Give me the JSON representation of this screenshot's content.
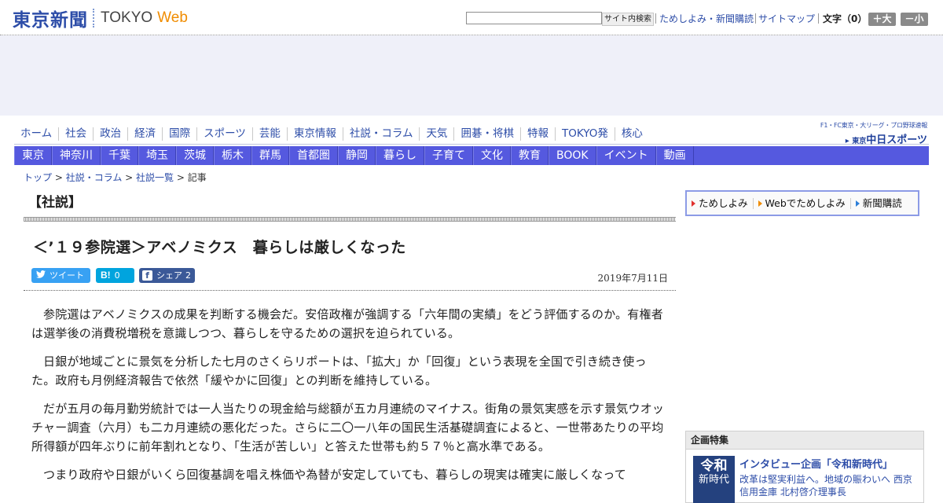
{
  "header": {
    "logo_jp": "東京新聞",
    "logo_tokyo": "TOKYO",
    "logo_web": "Web",
    "search_value": "",
    "search_button": "サイト内検索",
    "links": [
      "ためしよみ・新聞購読",
      "サイトマップ"
    ],
    "fontsize_label": "文字（0）",
    "bigger": "＋大",
    "smaller": "－小"
  },
  "nav_main": [
    "ホーム",
    "社会",
    "政治",
    "経済",
    "国際",
    "スポーツ",
    "芸能",
    "東京情報",
    "社説・コラム",
    "天気",
    "囲碁・将棋",
    "特報",
    "TOKYO発",
    "核心"
  ],
  "chunichi": {
    "top": "F1・FC東京・大リーグ・プロ野球速報",
    "prefix": "東京",
    "name": "中日スポーツ"
  },
  "nav_sub": [
    "東京",
    "神奈川",
    "千葉",
    "埼玉",
    "茨城",
    "栃木",
    "群馬",
    "首都圏",
    "静岡",
    "暮らし",
    "子育て",
    "文化",
    "教育",
    "BOOK",
    "イベント",
    "動画"
  ],
  "breadcrumb": {
    "items": [
      "トップ",
      "社説・コラム",
      "社説一覧"
    ],
    "current": "記事",
    "sep": " > "
  },
  "article": {
    "section": "【社説】",
    "title": "＜’１９参院選＞アベノミクス　暮らしは厳しくなった",
    "date": "2019年7月11日",
    "share": {
      "tweet": "ツイート",
      "hatena_icon": "B!",
      "hatena_count": "0",
      "fb_icon": "f",
      "fb_label": "シェア",
      "fb_count": "2"
    },
    "paragraphs": [
      "参院選はアベノミクスの成果を判断する機会だ。安倍政権が強調する「六年間の実績」をどう評価するのか。有権者は選挙後の消費税増税を意識しつつ、暮らしを守るための選択を迫られている。",
      "日銀が地域ごとに景気を分析した七月のさくらリポートは、「拡大」か「回復」という表現を全国で引き続き使った。政府も月例経済報告で依然「緩やかに回復」との判断を維持している。",
      "だが五月の毎月勤労統計では一人当たりの現金給与総額が五カ月連続のマイナス。街角の景気実感を示す景気ウオッチャー調査（六月）も二カ月連続の悪化だった。さらに二〇一八年の国民生活基礎調査によると、一世帯あたりの平均所得額が四年ぶりに前年割れとなり、「生活が苦しい」と答えた世帯も約５７％と高水準である。",
      "つまり政府や日銀がいくら回復基調を唱え株価や為替が安定していても、暮らしの現実は確実に厳しくなって"
    ]
  },
  "sidebar": {
    "subscribe": [
      "ためしよみ",
      "Webでためしよみ",
      "新聞購読"
    ],
    "feature": {
      "heading": "企画特集",
      "image_top": "令和",
      "image_bottom": "新時代",
      "title": "インタビュー企画「令和新時代」",
      "desc": "改革は堅実利益へ。地域の賑わいへ 西京信用金庫 北村啓介理事長"
    }
  },
  "colors": {
    "brand_blue": "#2d4da8",
    "nav_bar": "#5559df",
    "ad_bg": "#eff0f9",
    "logo_orange": "#f08c00"
  }
}
